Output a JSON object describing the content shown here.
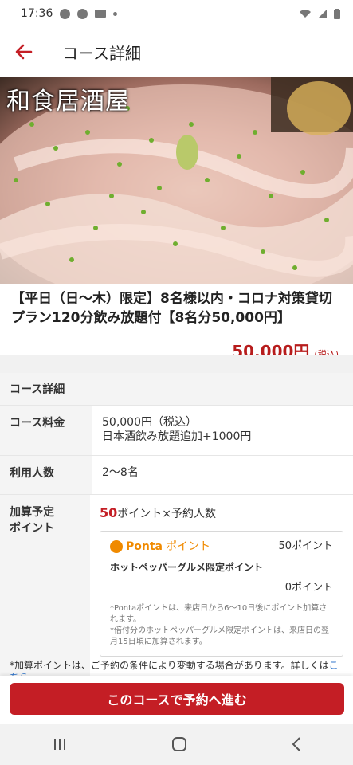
{
  "status": {
    "time": "17:36"
  },
  "appbar": {
    "title": "コース詳細"
  },
  "hero": {
    "shop_name": "和食居酒屋"
  },
  "plan": {
    "title": "【平日（日～木）限定】8名様以内・コロナ対策貸切プラン120分飲み放題付【8名分50,000円】",
    "price": "50,000円",
    "tax": "(税込)"
  },
  "details": {
    "header": "コース詳細",
    "fee_label": "コース料金",
    "fee_line1": "50,000円（税込）",
    "fee_line2": "日本酒飲み放題追加+1000円",
    "people_label": "利用人数",
    "people_value": "2～8名",
    "points_label_1": "加算予定",
    "points_label_2": "ポイント",
    "points_num": "50",
    "points_suffix": "ポイント×予約人数",
    "ponta_brand": "Ponta",
    "ponta_word": "ポイント",
    "ponta_points": "50ポイント",
    "hpg_label": "ホットペッパーグルメ限定ポイント",
    "hpg_points": "0ポイント",
    "note1": "*Pontaポイントは、来店日から6～10日後にポイント加算されます。",
    "note2": "*倍付分のホットペッパーグルメ限定ポイントは、来店日の翌月15日頃に加算されます。",
    "bottom_note": "*加算ポイントは、ご予約の条件により変動する場合があります。詳しくは",
    "bottom_link": "こちら。"
  },
  "cta": {
    "label": "このコースで予約へ進む"
  },
  "colors": {
    "accent": "#c41e25",
    "ponta": "#f08a00"
  }
}
